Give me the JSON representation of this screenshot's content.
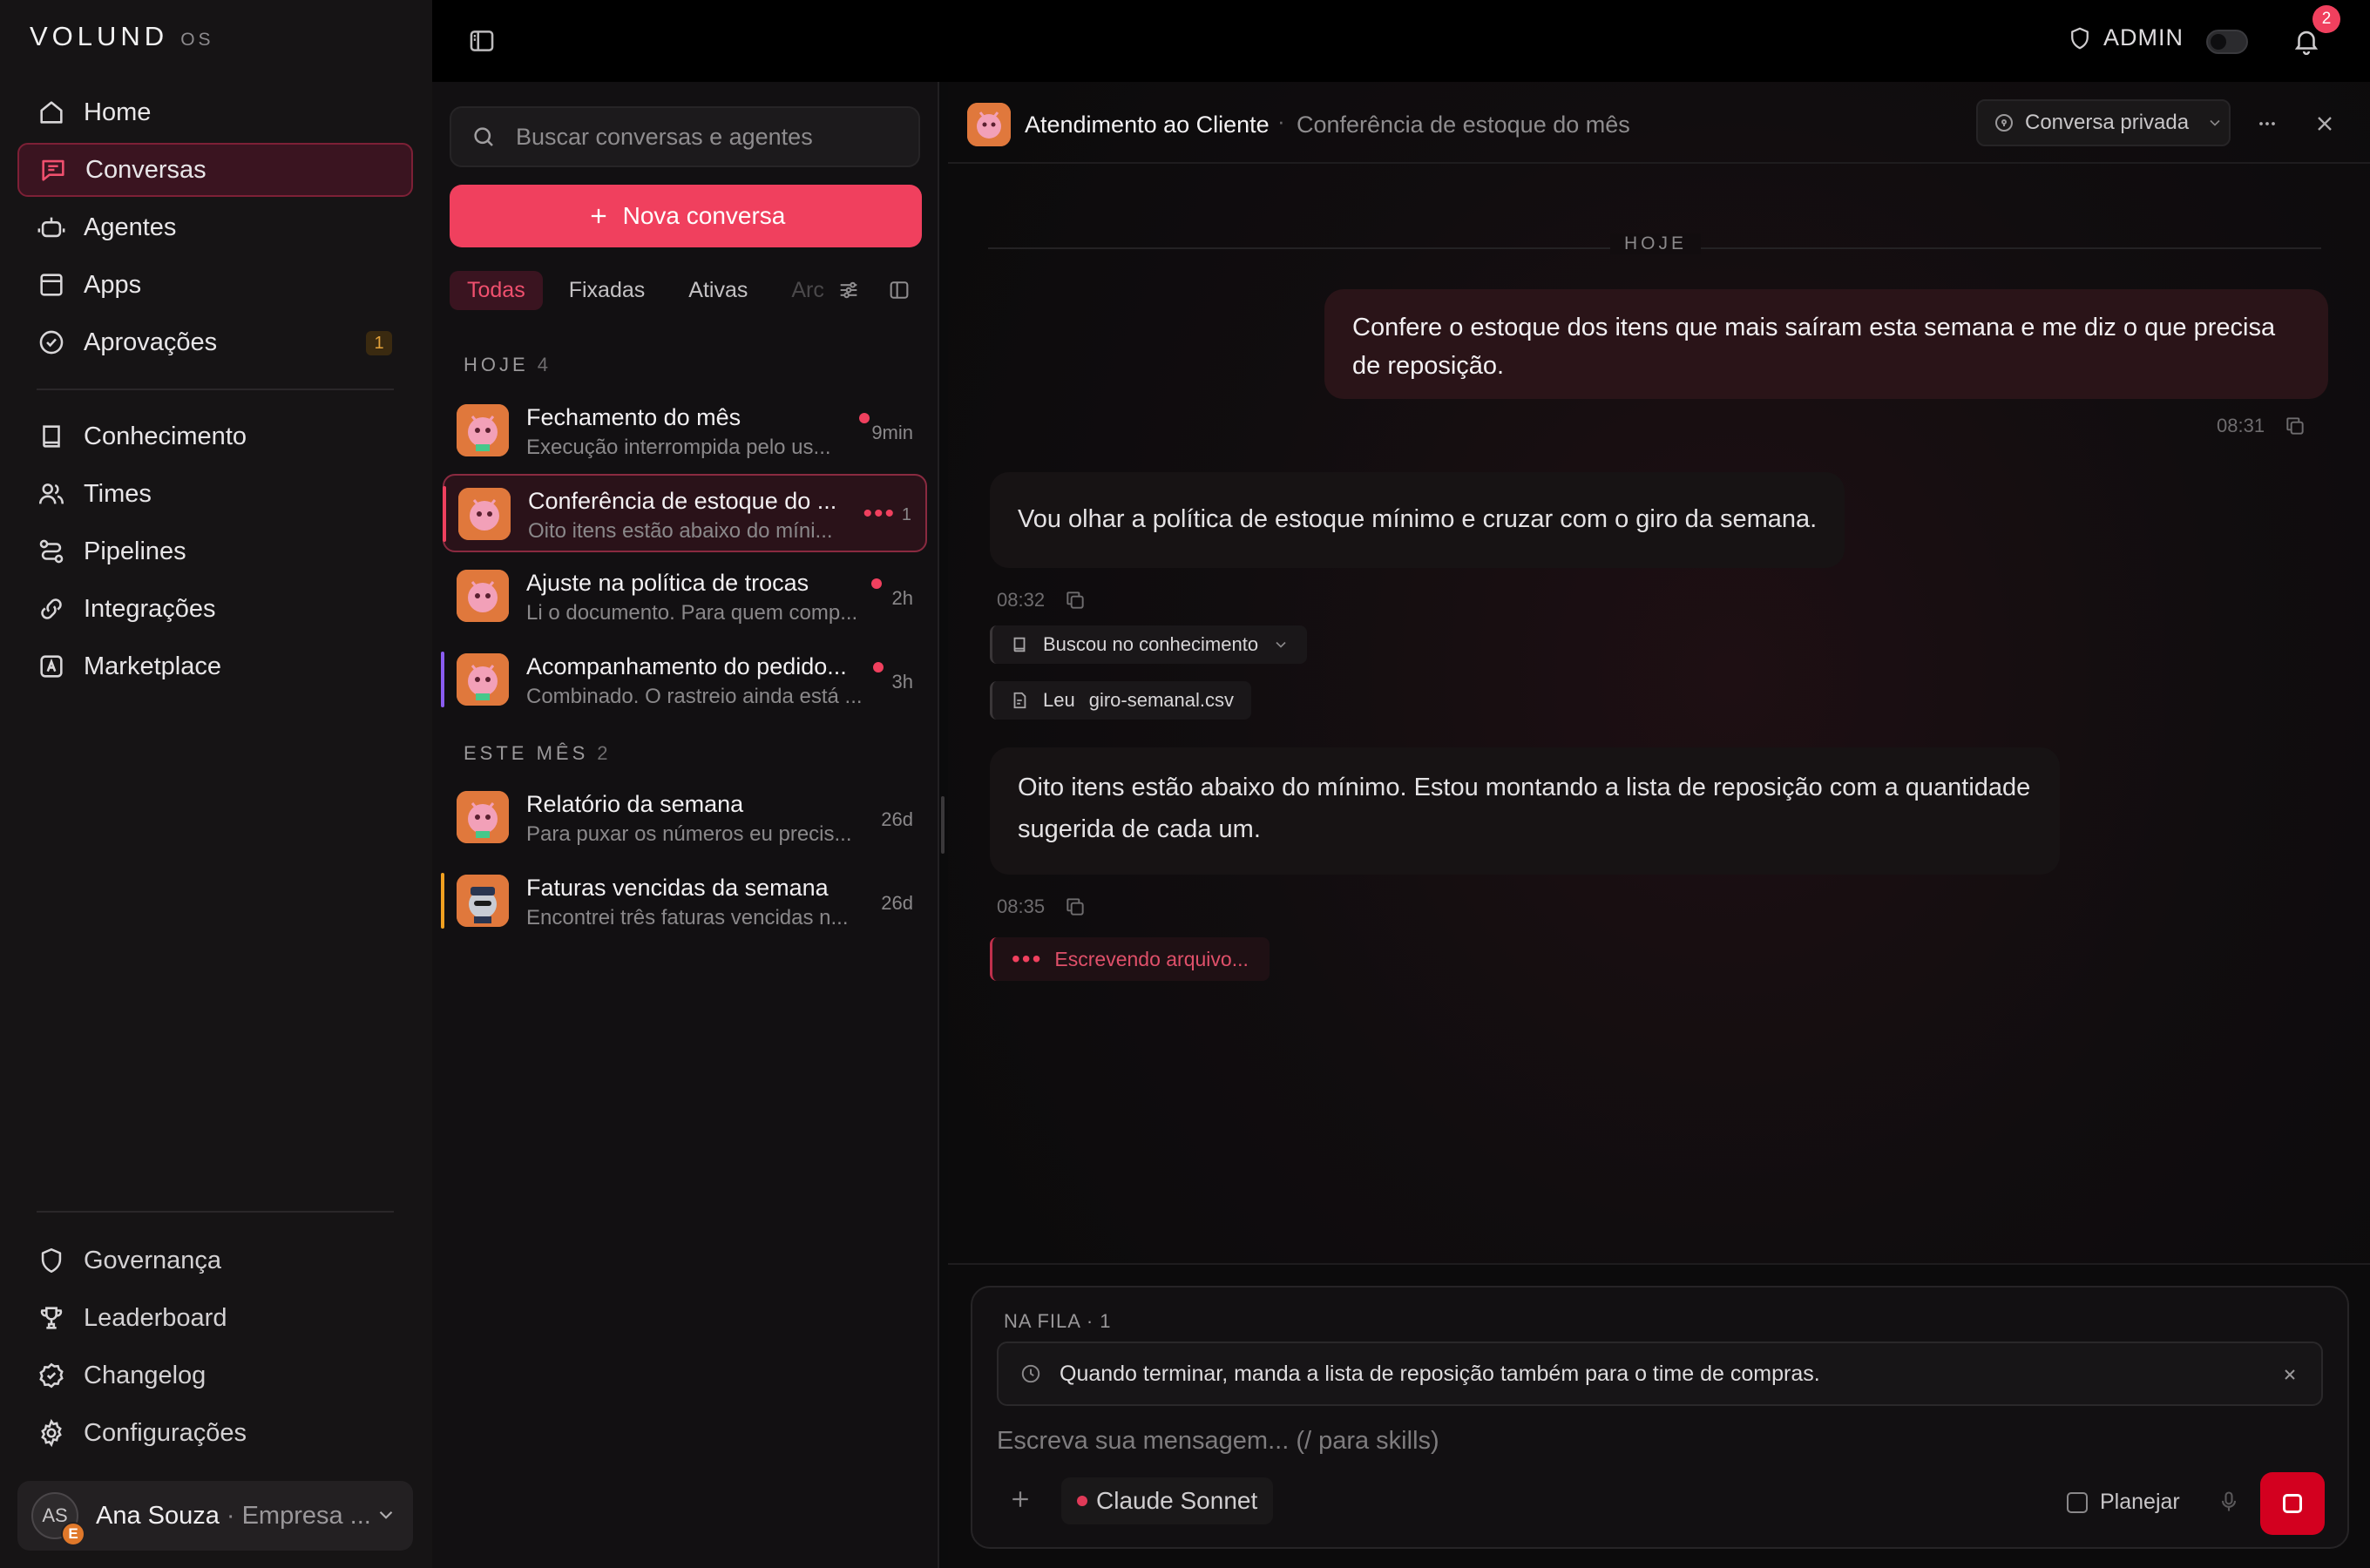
{
  "app": {
    "logo_word": "VOLUND",
    "logo_suffix": "OS"
  },
  "sidebar": {
    "items": [
      {
        "label": "Home",
        "icon": "home-icon"
      },
      {
        "label": "Conversas",
        "icon": "chat-icon",
        "active": true
      },
      {
        "label": "Agentes",
        "icon": "robot-icon"
      },
      {
        "label": "Apps",
        "icon": "apps-icon"
      },
      {
        "label": "Aprovações",
        "icon": "check-circle-icon",
        "badge": "1"
      },
      {
        "label": "Conhecimento",
        "icon": "book-icon"
      },
      {
        "label": "Times",
        "icon": "users-icon"
      },
      {
        "label": "Pipelines",
        "icon": "pipeline-icon"
      },
      {
        "label": "Integrações",
        "icon": "link-icon"
      },
      {
        "label": "Marketplace",
        "icon": "store-icon"
      }
    ],
    "bottom_items": [
      {
        "label": "Governança",
        "icon": "shield-icon"
      },
      {
        "label": "Leaderboard",
        "icon": "trophy-icon"
      },
      {
        "label": "Changelog",
        "icon": "badge-check-icon"
      },
      {
        "label": "Configurações",
        "icon": "gear-icon"
      }
    ],
    "user": {
      "initials": "AS",
      "org_initial": "E",
      "name": "Ana Souza",
      "separator": "·",
      "company": "Empresa ..."
    }
  },
  "topbar": {
    "admin_label": "ADMIN",
    "notification_count": "2"
  },
  "conversations": {
    "search_placeholder": "Buscar conversas e agentes",
    "new_button": "Nova conversa",
    "filters": [
      "Todas",
      "Fixadas",
      "Ativas",
      "Arc"
    ],
    "sections": [
      {
        "label": "HOJE",
        "count": "4"
      },
      {
        "label": "ESTE MÊS",
        "count": "2"
      }
    ],
    "items": [
      {
        "title": "Fechamento do mês",
        "subtitle": "Execução interrompida pelo us...",
        "time": "9min"
      },
      {
        "title": "Conferência de estoque do ...",
        "subtitle": "Oito itens estão abaixo do míni...",
        "typing": "•••",
        "count": "1"
      },
      {
        "title": "Ajuste na política de trocas",
        "subtitle": "Li o documento. Para quem comp...",
        "time": "2h"
      },
      {
        "title": "Acompanhamento do pedido...",
        "subtitle": "Combinado. O rastreio ainda está ...",
        "time": "3h"
      },
      {
        "title": "Relatório da semana",
        "subtitle": "Para puxar os números eu precis...",
        "time": "26d"
      },
      {
        "title": "Faturas vencidas da semana",
        "subtitle": "Encontrei três faturas vencidas n...",
        "time": "26d"
      }
    ],
    "colors": {
      "accent": "#f0405e",
      "bar_purple": "#8a5cf0",
      "bar_amber": "#f0a020"
    }
  },
  "chat": {
    "agent_name": "Atendimento ao Cliente",
    "separator": "·",
    "title": "Conferência de estoque do mês",
    "privacy_label": "Conversa privada",
    "day_label": "HOJE",
    "messages": {
      "user_text": "Confere o estoque dos itens que mais saíram esta semana e me diz o que precisa de reposição.",
      "user_time": "08:31",
      "agent1_text": "Vou olhar a política de estoque mínimo e cruzar com o giro da semana.",
      "agent1_time": "08:32",
      "tool1_label": "Buscou no conhecimento",
      "tool2_label": "Leu",
      "tool2_file": "giro-semanal.csv",
      "agent2_text": "Oito itens estão abaixo do mínimo. Estou montando a lista de reposição com a quantidade sugerida de cada um.",
      "agent2_time": "08:35",
      "writing_dots": "•••",
      "writing_label": "Escrevendo arquivo..."
    }
  },
  "composer": {
    "queue_label": "NA FILA · 1",
    "queue_item": "Quando terminar, manda a lista de reposição também para o time de compras.",
    "placeholder": "Escreva sua mensagem... (/ para skills)",
    "model_label": "Claude Sonnet",
    "plan_label": "Planejar"
  }
}
